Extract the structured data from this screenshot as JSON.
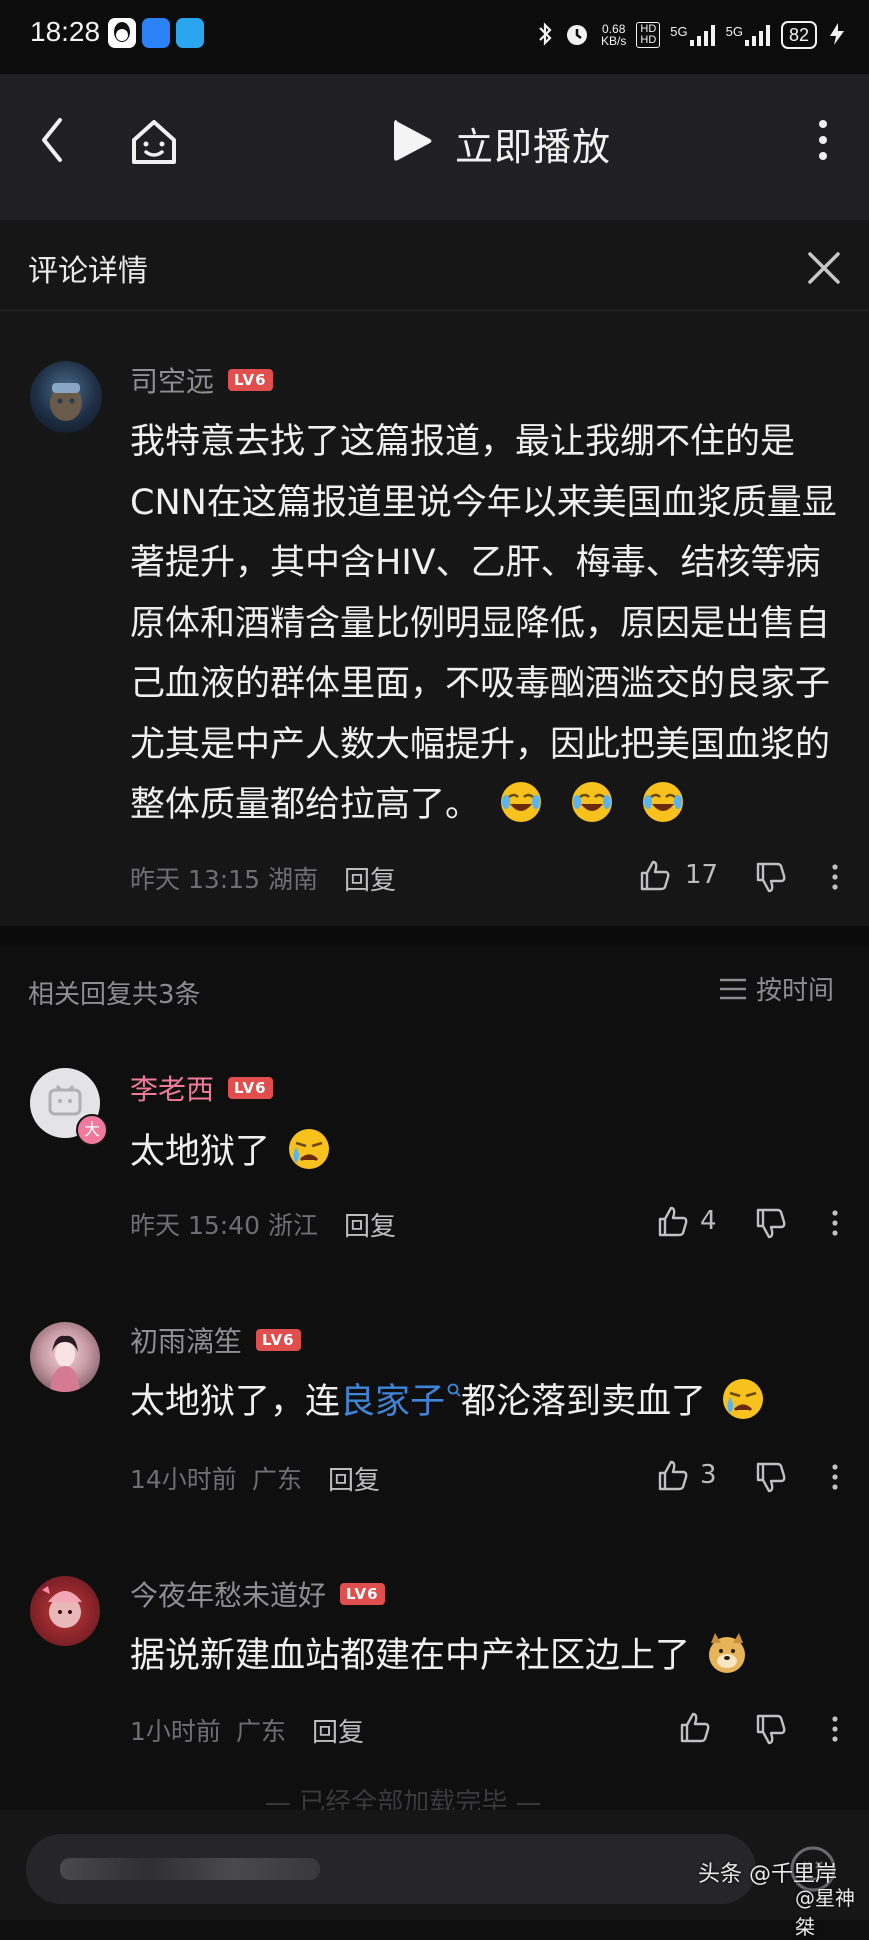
{
  "status_bar": {
    "time": "18:28",
    "net_speed_top": "0.68",
    "net_speed_bottom": "KB/s",
    "hd1": "HD",
    "hd2": "HD",
    "sig1": "5G",
    "sig2": "5G",
    "battery": "82"
  },
  "nav": {
    "title": "立即播放"
  },
  "detail_header": {
    "title": "评论详情"
  },
  "main_comment": {
    "user": "司空远",
    "level": "LV6",
    "lines": [
      "我特意去找了这篇报道，最让我绷不住的是",
      "CNN在这篇报道里说今年以来美国血浆质量显",
      "著提升，其中含HIV、乙肝、梅毒、结核等病",
      "原体和酒精含量比例明显降低，原因是出售自",
      "己血液的群体里面，不吸毒酗酒滥交的良家子",
      "尤其是中产人数大幅提升，因此把美国血浆的",
      "整体质量都给拉高了。"
    ],
    "time": "昨天 13:15",
    "location": "湖南",
    "reply": "回复",
    "likes": "17"
  },
  "replies_header": {
    "label": "相关回复共3条",
    "sort": "按时间"
  },
  "replies": [
    {
      "user": "李老西",
      "level": "LV6",
      "text": "太地狱了",
      "time": "昨天 15:40",
      "location": "浙江",
      "reply": "回复",
      "likes": "4",
      "badge": "大"
    },
    {
      "user": "初雨漓笙",
      "level": "LV6",
      "text_before": "太地狱了，连",
      "text_link": "良家子",
      "text_after": "都沦落到卖血了",
      "time": "14小时前",
      "location": "广东",
      "reply": "回复",
      "likes": "3"
    },
    {
      "user": "今夜年愁未道好",
      "level": "LV6",
      "text": "据说新建血站都建在中产社区边上了",
      "time": "1小时前",
      "location": "广东",
      "reply": "回复"
    }
  ],
  "footer": {
    "hint": "—  已经全部加载完毕  —",
    "watermark_a": "头条 @千里岸",
    "watermark_b": "@星神桀"
  },
  "colors": {
    "background": "#161617",
    "accent_level": "#e04e4e",
    "username_pink": "#f07a9e",
    "link_blue": "#3f86d9"
  }
}
